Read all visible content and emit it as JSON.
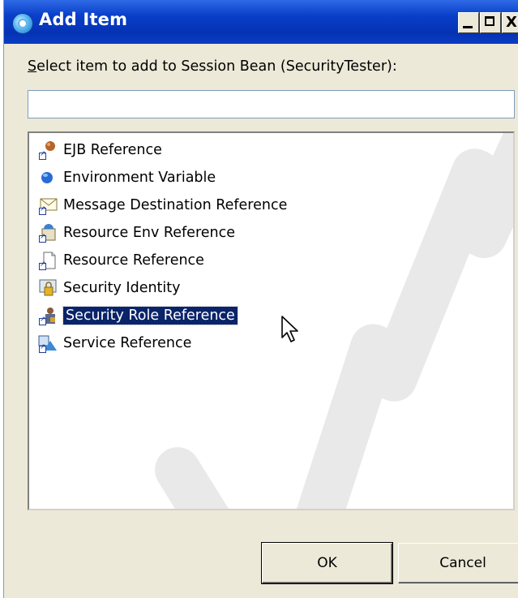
{
  "window": {
    "title": "Add Item",
    "controls": {
      "minimize": "_",
      "maximize": "□",
      "close": "X"
    }
  },
  "prompt": {
    "label_rest": "elect item to add to Session Bean (SecurityTester):",
    "mnemonic": "S"
  },
  "filter": {
    "value": "",
    "placeholder": ""
  },
  "items": [
    {
      "label": "EJB Reference",
      "icon": "ejb-reference-icon",
      "selected": false
    },
    {
      "label": "Environment Variable",
      "icon": "environment-variable-icon",
      "selected": false
    },
    {
      "label": "Message Destination Reference",
      "icon": "message-destination-icon",
      "selected": false
    },
    {
      "label": "Resource Env Reference",
      "icon": "resource-env-icon",
      "selected": false
    },
    {
      "label": "Resource Reference",
      "icon": "resource-reference-icon",
      "selected": false
    },
    {
      "label": "Security Identity",
      "icon": "security-identity-icon",
      "selected": false
    },
    {
      "label": "Security Role Reference",
      "icon": "security-role-icon",
      "selected": true
    },
    {
      "label": "Service Reference",
      "icon": "service-reference-icon",
      "selected": false
    }
  ],
  "buttons": {
    "ok": "OK",
    "cancel": "Cancel"
  },
  "colors": {
    "selection": "#0a246a",
    "titlebar": "#0a3cc4",
    "dialog_bg": "#ece9d8"
  }
}
